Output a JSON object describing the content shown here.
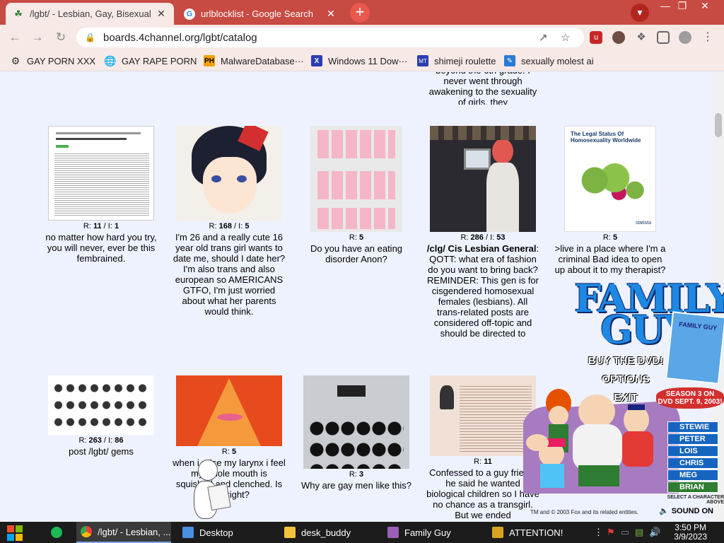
{
  "browser": {
    "tabs": [
      {
        "title": "/lgbt/ - Lesbian, Gay, Bisexual",
        "favicon": "clover-icon",
        "active": true
      },
      {
        "title": "urlblocklist - Google Search",
        "favicon": "google-icon",
        "active": false
      }
    ],
    "url": "boards.4channel.org/lgbt/catalog",
    "bookmarks": [
      {
        "label": "GAY PORN XXX"
      },
      {
        "label": "GAY RAPE PORN"
      },
      {
        "label": "MalwareDatabase···"
      },
      {
        "label": "Windows 11 Dow···"
      },
      {
        "label": "shimeji roulette"
      },
      {
        "label": "sexually molest ai"
      }
    ],
    "accent": "#c74a43"
  },
  "catalog": {
    "partial_top_text": "beyond the 6th grade. I never went through awakening to the sexuality of girls, they",
    "threads": [
      {
        "r": "11",
        "i": "1",
        "subject": "",
        "teaser": "no matter how hard you try, you will never, ever be this fembrained."
      },
      {
        "r": "168",
        "i": "5",
        "subject": "",
        "teaser": "I'm 26 and a really cute 16 year old trans girl wants to date me, should I date her? I'm also trans and also european so AMERICANS GTFO, I'm just worried about what her parents would think."
      },
      {
        "r": "5",
        "i": "",
        "subject": "",
        "teaser": "Do you have an eating disorder Anon?"
      },
      {
        "r": "286",
        "i": "53",
        "subject": "/clg/ Cis Lesbian General",
        "teaser": ": QOTT: what era of fashion do you want to bring back? REMINDER: This gen is for cisgendered homosexual females (lesbians). All trans-related posts are considered off-topic and should be directed to"
      },
      {
        "r": "5",
        "i": "",
        "subject": "",
        "teaser": ">live in a place where I'm a criminal Bad idea to open up about it to my therapist?"
      },
      {
        "r": "263",
        "i": "86",
        "subject": "",
        "teaser": "post /lgbt/ gems"
      },
      {
        "r": "5",
        "i": "",
        "subject": "",
        "teaser": "when i raise my larynx i feel my whole mouth is squished and clenched. Is that right?"
      },
      {
        "r": "3",
        "i": "",
        "subject": "",
        "teaser": "Why are gay men like this?"
      },
      {
        "r": "11",
        "i": "",
        "subject": "",
        "teaser": "Confessed to a guy friend, he said he wanted biological children so I have no chance as a transgirl. But we ended"
      }
    ],
    "map_thumb": {
      "title": "The Legal Status Of Homosexuality Worldwide",
      "brand": "statista"
    }
  },
  "ad": {
    "logo_line1": "FAMILY",
    "logo_line2": "GUY",
    "buy": "BUY THE DVD!",
    "options": "OPTIONS",
    "exit": "EXIT",
    "dvd_label": "FAMILY GUY",
    "season": "SEASON 3 ON DVD SEPT. 9, 2003!",
    "characters": [
      "STEWIE",
      "PETER",
      "LOIS",
      "CHRIS",
      "MEG",
      "BRIAN"
    ],
    "select_hint": "SELECT A CHARACTER ABOVE",
    "legal": "TM and © 2003 Fox and its related entities.",
    "sound": "SOUND ON"
  },
  "taskbar": {
    "items": [
      {
        "label": "/lgbt/ - Lesbian, ...",
        "icon": "chrome-icon"
      },
      {
        "label": "Desktop",
        "icon": "desktop-icon"
      },
      {
        "label": "desk_buddy",
        "icon": "folder-icon"
      },
      {
        "label": "Family Guy",
        "icon": "familyguy-icon"
      },
      {
        "label": "ATTENTION!",
        "icon": "attention-icon"
      }
    ],
    "time": "3:50 PM",
    "date": "3/9/2023"
  }
}
